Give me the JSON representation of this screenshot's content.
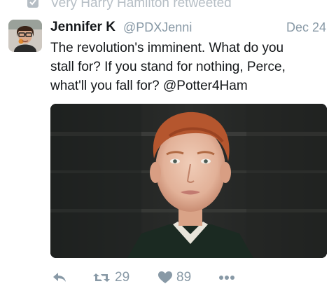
{
  "retweet_context": {
    "text": "Very Harry Hamilton retweeted",
    "icon": "retweet-icon"
  },
  "tweet": {
    "display_name": "Jennifer K",
    "handle": "@PDXJenni",
    "date": "Dec 24",
    "text_lines": [
      "The revolution's imminent. What do you",
      "stall for? If you stand for nothing, Perce,",
      "what'll you fall for? @Potter4Ham"
    ]
  },
  "actions": {
    "reply_icon": "reply-icon",
    "retweet_count": "29",
    "like_count": "89",
    "more_icon": "more-icon"
  },
  "colors": {
    "text": "#14171a",
    "secondary": "#8899a6",
    "muted": "#b6bec5",
    "background": "#ffffff"
  }
}
